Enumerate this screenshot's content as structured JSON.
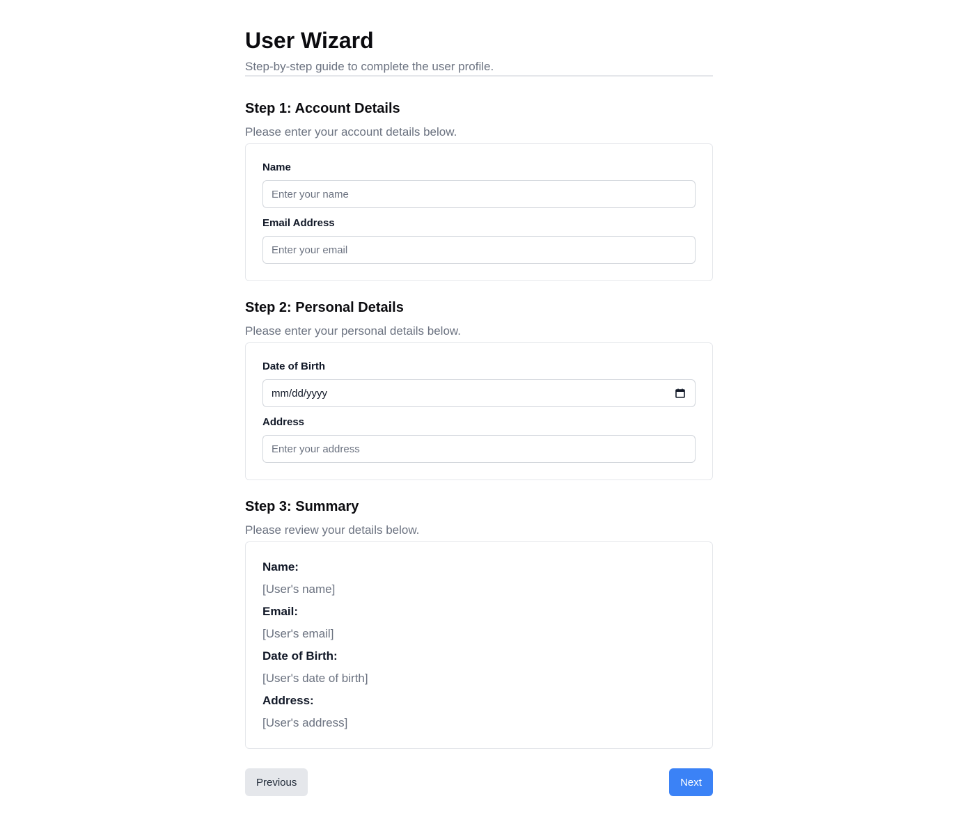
{
  "header": {
    "title": "User Wizard",
    "subtitle": "Step-by-step guide to complete the user profile."
  },
  "steps": [
    {
      "title": "Step 1: Account Details",
      "description": "Please enter your account details below.",
      "fields": [
        {
          "label": "Name",
          "placeholder": "Enter your name",
          "value": ""
        },
        {
          "label": "Email Address",
          "placeholder": "Enter your email",
          "value": ""
        }
      ]
    },
    {
      "title": "Step 2: Personal Details",
      "description": "Please enter your personal details below.",
      "fields": [
        {
          "label": "Date of Birth",
          "display": "mm/dd/yyyy",
          "icon": "calendar-icon"
        },
        {
          "label": "Address",
          "placeholder": "Enter your address",
          "value": ""
        }
      ]
    },
    {
      "title": "Step 3: Summary",
      "description": "Please review your details below.",
      "summary": [
        {
          "label": "Name:",
          "value": "[User's name]"
        },
        {
          "label": "Email:",
          "value": "[User's email]"
        },
        {
          "label": "Date of Birth:",
          "value": "[User's date of birth]"
        },
        {
          "label": "Address:",
          "value": "[User's address]"
        }
      ]
    }
  ],
  "navigation": {
    "previous_label": "Previous",
    "next_label": "Next"
  },
  "colors": {
    "accent": "#3b82f6",
    "muted_text": "#6b7280",
    "border": "#e5e7eb",
    "secondary_button": "#e5e7eb"
  }
}
